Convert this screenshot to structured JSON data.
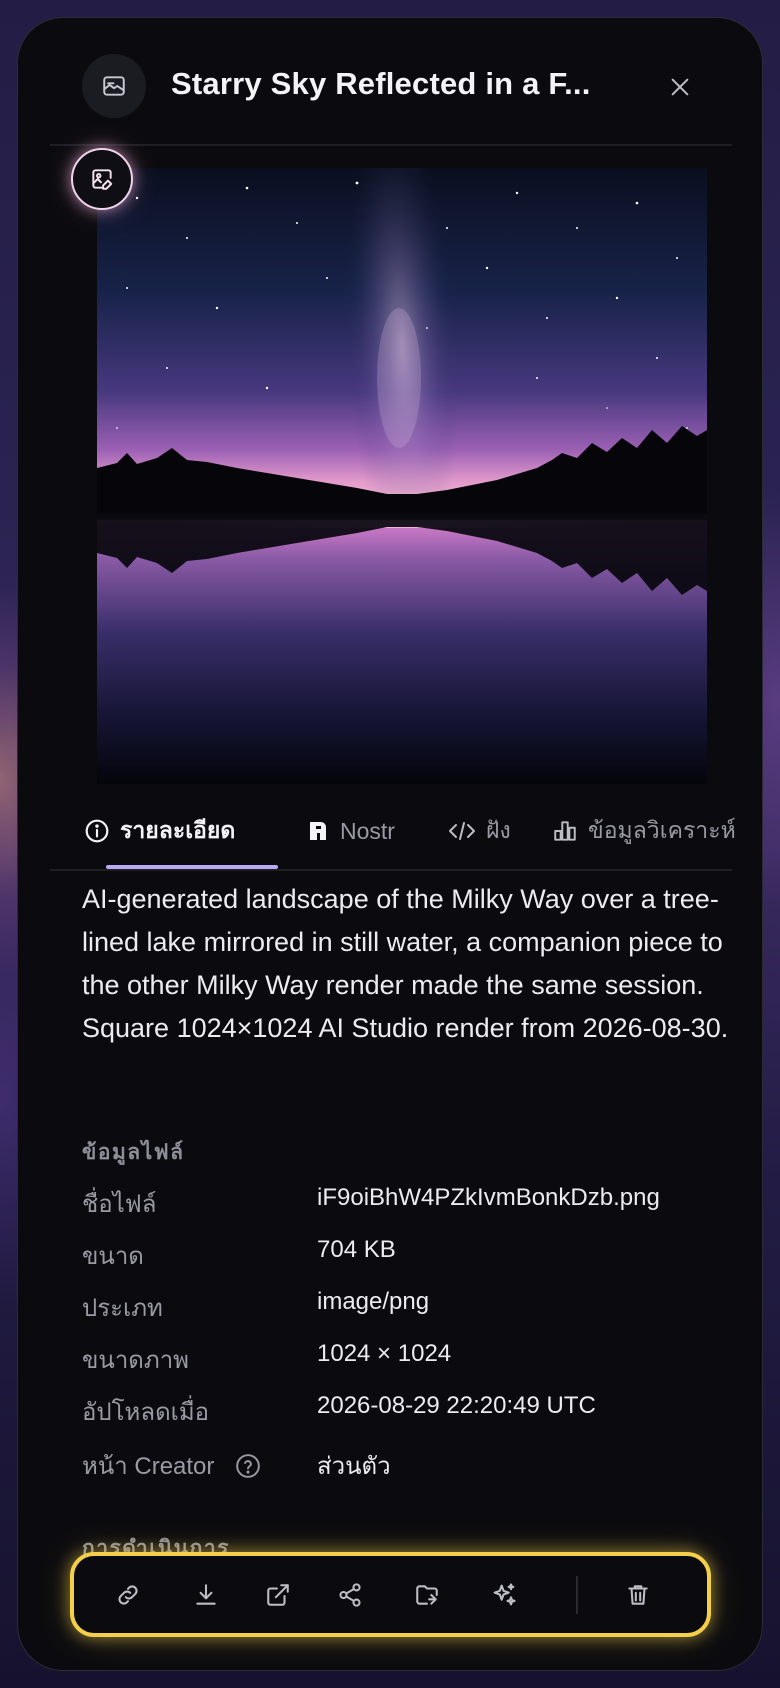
{
  "header": {
    "title": "Starry Sky Reflected in a F...",
    "image_icon": "image-icon",
    "close_icon": "close-icon"
  },
  "image": {
    "alt": "Milky Way over a tree-lined lake reflected in still water",
    "edit_icon": "image-edit-icon"
  },
  "tabs": [
    {
      "label": "รายละเอียด",
      "icon": "info-icon",
      "active": true
    },
    {
      "label": "Nostr",
      "icon": "nostr-icon",
      "active": false
    },
    {
      "label": "ฝัง",
      "icon": "code-icon",
      "active": false
    },
    {
      "label": "ข้อมูลวิเคราะห์",
      "icon": "bar-chart-icon",
      "active": false
    }
  ],
  "description": "AI-generated landscape of the Milky Way over a tree-lined lake mirrored in still water, a companion piece to the other Milky Way render made the same session. Square 1024×1024 AI Studio render from 2026-08-30.",
  "file_info": {
    "title": "ข้อมูลไฟล์",
    "rows": [
      {
        "key": "ชื่อไฟล์",
        "value": "iF9oiBhW4PZkIvmBonkDzb.png"
      },
      {
        "key": "ขนาด",
        "value": "704 KB"
      },
      {
        "key": "ประเภท",
        "value": "image/png"
      },
      {
        "key": "ขนาดภาพ",
        "value": "1024 × 1024"
      },
      {
        "key": "อัปโหลดเมื่อ",
        "value": "2026-08-29 22:20:49 UTC"
      },
      {
        "key": "หน้า Creator",
        "value": "ส่วนตัว",
        "help_icon": "help-icon"
      }
    ]
  },
  "actions": {
    "title": "การดำเนินการ",
    "buttons": [
      "link-icon",
      "download-icon",
      "external-link-icon",
      "share-icon",
      "move-folder-icon",
      "sparkles-icon",
      "trash-icon"
    ]
  },
  "colors": {
    "accent": "#b9a8f4",
    "highlight": "#f3cf4b",
    "panel_bg": "#0b0b0f"
  }
}
